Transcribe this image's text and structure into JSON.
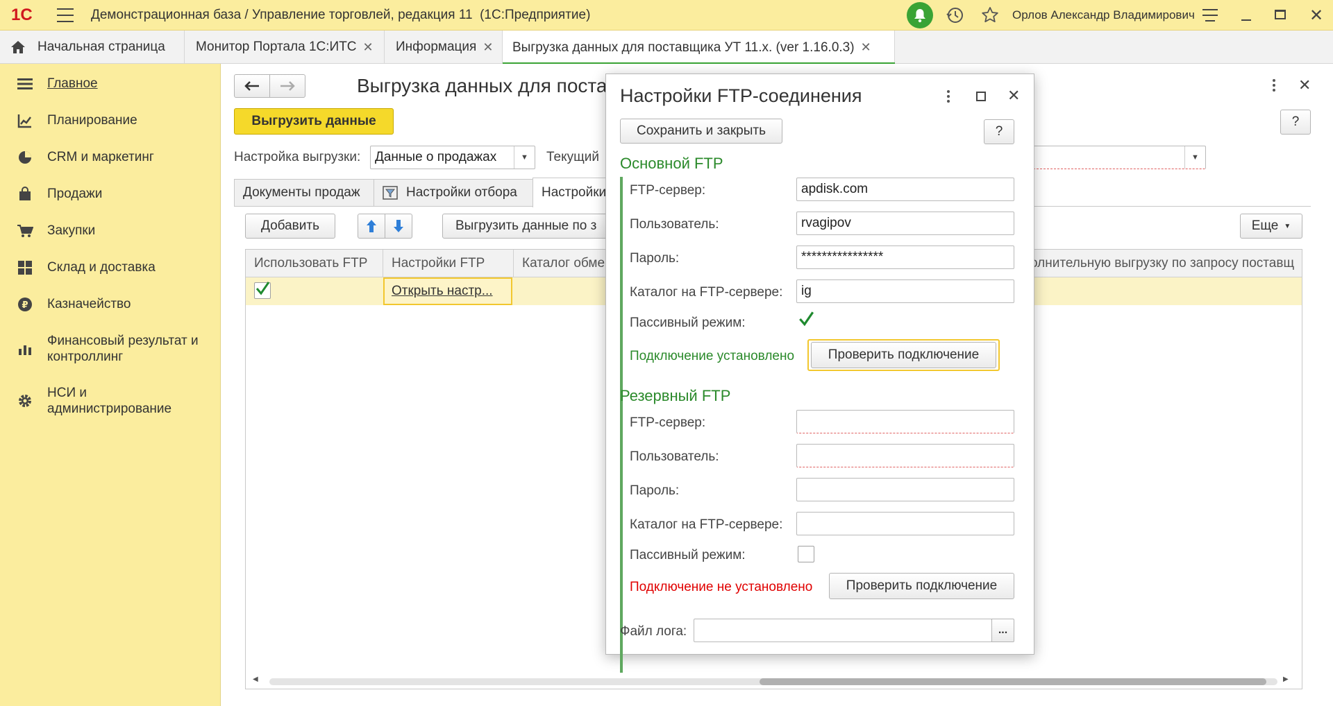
{
  "app": {
    "title": "Демонстрационная база / Управление торговлей, редакция 11  (1С:Предприятие)",
    "user": "Орлов Александр Владимирович",
    "logo": "1С"
  },
  "tabs": [
    {
      "label": "Начальная страница"
    },
    {
      "label": "Монитор Портала 1С:ИТС"
    },
    {
      "label": "Информация"
    },
    {
      "label": "Выгрузка данных для поставщика УТ 11.х. (ver 1.16.0.3)"
    }
  ],
  "sidebar": {
    "items": [
      {
        "label": "Главное",
        "icon": "menu-lines-icon"
      },
      {
        "label": "Планирование",
        "icon": "planning-icon"
      },
      {
        "label": "CRM и маркетинг",
        "icon": "pie-chart-icon"
      },
      {
        "label": "Продажи",
        "icon": "shopping-bag-icon"
      },
      {
        "label": "Закупки",
        "icon": "cart-icon"
      },
      {
        "label": "Склад и доставка",
        "icon": "warehouse-grid-icon"
      },
      {
        "label": "Казначейство",
        "icon": "ruble-coin-icon"
      },
      {
        "label": "Финансовый результат и контроллинг",
        "icon": "bar-chart-icon"
      },
      {
        "label": "НСИ и администрирование",
        "icon": "gear-icon"
      }
    ]
  },
  "form": {
    "title": "Выгрузка данных для поставщика УТ 11.х. (ver 1.16.0.3)",
    "upload_button": "Выгрузить данные",
    "help": "?",
    "setting_label": "Настройка выгрузки:",
    "setting_value": "Данные о продажах",
    "current_label": "Текущий",
    "page_tabs": [
      "Документы продаж",
      "Настройки отбора",
      "Настройки"
    ],
    "add_button": "Добавить",
    "export_by_button": "Выгрузить данные по з",
    "more_button": "Еще",
    "table": {
      "columns": [
        "Использовать FTP",
        "Настройки FTP",
        "Каталог обме",
        "олнительную выгрузку по запросу поставщ"
      ],
      "rows": [
        {
          "use_ftp": true,
          "settings": "Открыть настр..."
        }
      ]
    }
  },
  "dialog": {
    "title": "Настройки FTP-соединения",
    "save_close": "Сохранить и закрыть",
    "help": "?",
    "primary": {
      "heading": "Основной FTP",
      "server_label": "FTP-сервер:",
      "server": "apdisk.com",
      "user_label": "Пользователь:",
      "user": "rvagipov",
      "password_label": "Пароль:",
      "password": "****************",
      "dir_label": "Каталог на FTP-сервере:",
      "dir": "ig",
      "passive_label": "Пассивный режим:",
      "passive": true,
      "status": "Подключение установлено",
      "check_button": "Проверить подключение"
    },
    "backup": {
      "heading": "Резервный FTP",
      "server_label": "FTP-сервер:",
      "server": "",
      "user_label": "Пользователь:",
      "user": "",
      "password_label": "Пароль:",
      "password": "",
      "dir_label": "Каталог на FTP-сервере:",
      "dir": "",
      "passive_label": "Пассивный режим:",
      "passive": false,
      "status": "Подключение не установлено",
      "check_button": "Проверить подключение"
    },
    "log_label": "Файл лога:",
    "log_value": "",
    "ellipsis": "..."
  },
  "colors": {
    "accent_yellow": "#fbed9e",
    "upload_button": "#f5d92a",
    "ok_green": "#2b8a2b",
    "error_red": "#e00000",
    "notification_green": "#3aa335"
  }
}
